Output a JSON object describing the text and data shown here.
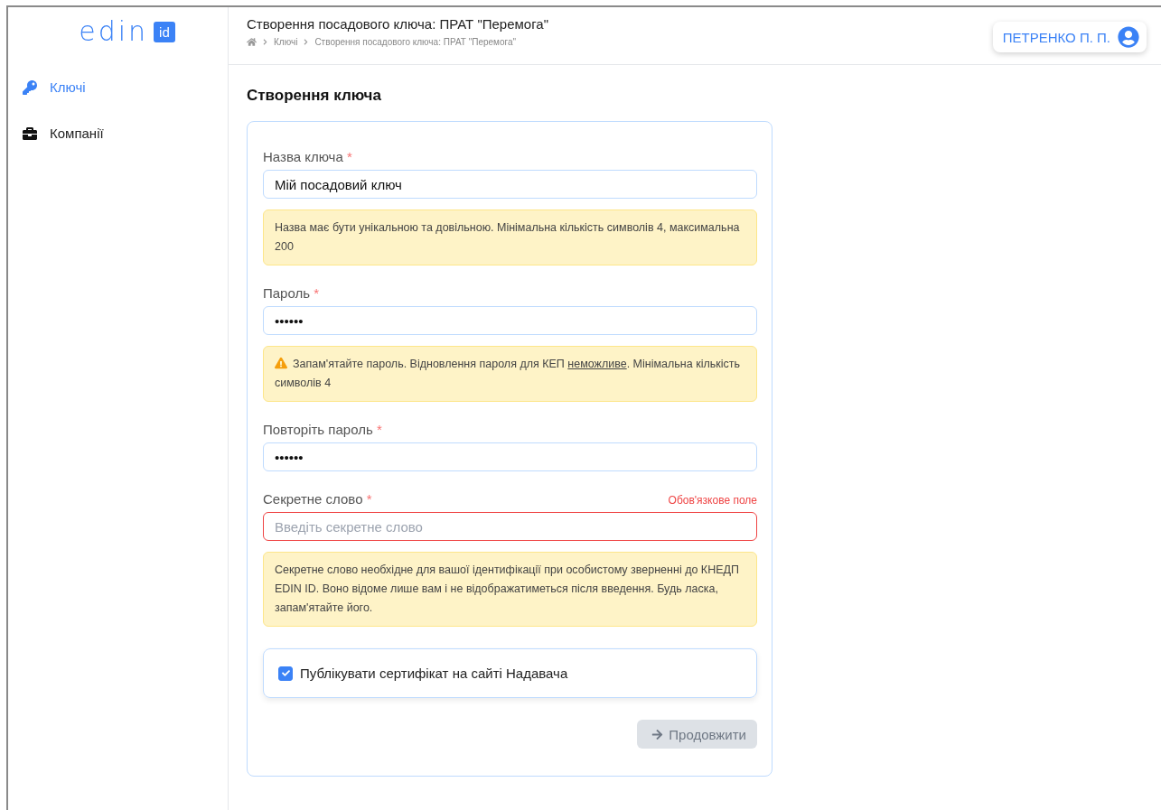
{
  "logo": {
    "word": "edin",
    "badge": "id"
  },
  "sidebar": {
    "items": [
      {
        "label": "Ключі",
        "selected": true
      },
      {
        "label": "Компанії",
        "selected": false
      }
    ]
  },
  "header": {
    "title": "Створення посадового ключа: ПРАТ \"Перемога\"",
    "breadcrumbs": [
      "Ключі",
      "Створення посадового ключа: ПРАТ \"Перемога\""
    ],
    "user": "ПЕТРЕНКО П. П."
  },
  "form": {
    "title": "Створення ключа",
    "fields": [
      {
        "label": "Назва ключа",
        "required_mark": "*",
        "value": "Мій посадовий ключ",
        "note": {
          "text": "Назва має бути унікальною та довільною. Мінімальна кількість символів 4, максимальна 200"
        }
      },
      {
        "label": "Пароль",
        "required_mark": "*",
        "value": "••••••",
        "note": {
          "kind": "warning",
          "text": "Запам'ятайте пароль. Відновлення пароля для КЕП ",
          "link": "неможливе",
          "after": ". Мінімальна кількість символів 4"
        }
      },
      {
        "label": "Повторіть пароль",
        "required_mark": "*",
        "value": "••••••"
      },
      {
        "label": "Секретне слово",
        "required_mark": "*",
        "placeholder": "Введіть секретне слово",
        "error": "Обов'язкове поле",
        "note": {
          "text": "Секретне слово необхідне для вашої ідентифікації при особистому зверненні до КНЕДП EDIN ID. Воно відоме лише вам і не відображатиметься після введення. Будь ласка, запам'ятайте його."
        }
      }
    ],
    "checkbox": {
      "label": "Публікувати сертифікат на сайті Надавача",
      "checked": true
    },
    "submit": {
      "label": "Продовжити",
      "disabled": true
    }
  }
}
